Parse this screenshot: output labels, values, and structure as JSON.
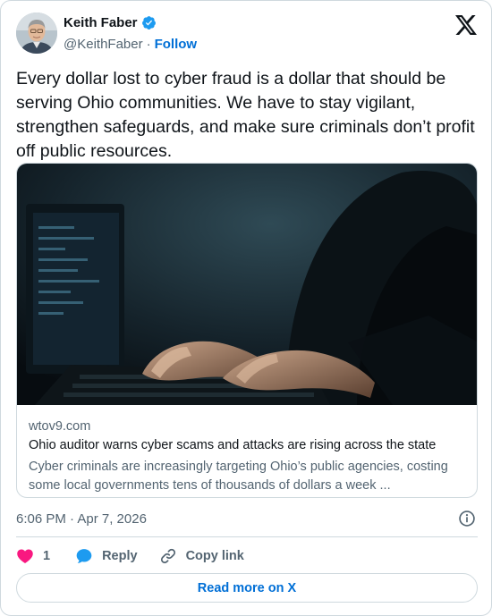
{
  "author": {
    "name": "Keith Faber",
    "handle": "@KeithFaber",
    "separator": "·",
    "follow_label": "Follow"
  },
  "tweet": {
    "text": "Every dollar lost to cyber fraud is a dollar that should be serving Ohio communities. We have to stay vigilant, strengthen safeguards, and make sure criminals don’t profit off public resources."
  },
  "link_card": {
    "domain": "wtov9.com",
    "title": "Ohio auditor warns cyber scams and attacks are rising across the state",
    "description": "Cyber criminals are increasingly targeting Ohio’s public agencies, costing some local governments tens of thousands of dollars a week ..."
  },
  "meta": {
    "timestamp": "6:06 PM · Apr 7, 2026"
  },
  "actions": {
    "like_count": "1",
    "reply_label": "Reply",
    "copy_label": "Copy link"
  },
  "read_more_label": "Read more on X",
  "icons": {
    "verified": "verified-badge-icon",
    "logo": "x-logo-icon",
    "info": "info-icon",
    "like": "heart-icon",
    "reply": "speech-bubble-icon",
    "copy": "link-icon"
  },
  "colors": {
    "accent": "#006fd6",
    "verified": "#1d9bf0",
    "like": "#f91880",
    "text": "#0f1419",
    "muted": "#536471",
    "border": "#cfd9de"
  }
}
